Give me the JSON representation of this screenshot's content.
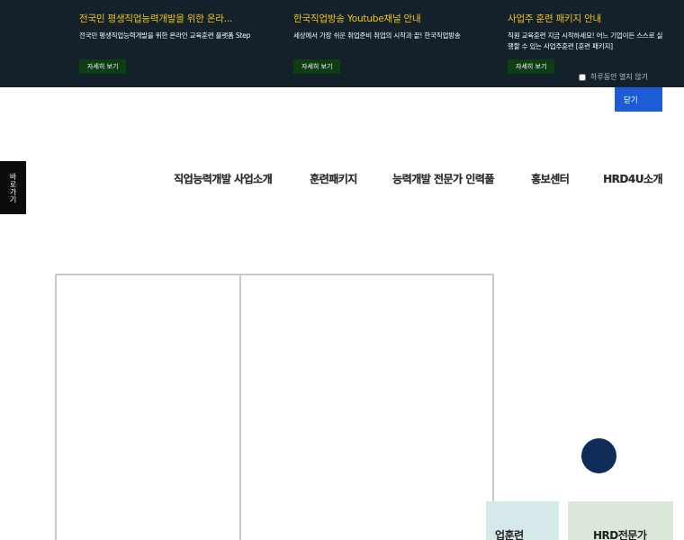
{
  "popup": {
    "items": [
      {
        "title": "전국민 평생직업능력개발을 위한 온라...",
        "description": "전국민 평생직업능력개발을 위한 온라인 교육훈련 플랫폼 Step",
        "button": "자세히 보기"
      },
      {
        "title": "한국직업방송 Youtube채널 안내",
        "description": "세상에서 가장 쉬운 취업준비 취업의 시작과 끝! 한국직업방송",
        "button": "자세히 보기"
      },
      {
        "title": "사업주 훈련 패키지 안내",
        "description": "직원 교육훈련 지금 시작하세요! 어느 기업이든 스스로 실행할 수 있는 사업주훈련 [훈련 패키지]",
        "button": "자세히 보기"
      }
    ],
    "today_close_label": "하루동안 열지 않기",
    "close_label": "닫기"
  },
  "side_tab": {
    "label": "바로가기"
  },
  "nav": {
    "items": [
      "직업능력개발 사업소개",
      "훈련패키지",
      "능력개발 전문가 인력풀",
      "홍보센터",
      "HRD4U소개"
    ]
  },
  "cards": {
    "card1": "업훈련",
    "card2": "HRD전문가"
  },
  "colors": {
    "banner_bg": "#14212a",
    "promo_title": "#f0c419",
    "promo_button": "#0d3d12",
    "close_button": "#1c5cd6",
    "circle_button": "#0f2b57"
  }
}
